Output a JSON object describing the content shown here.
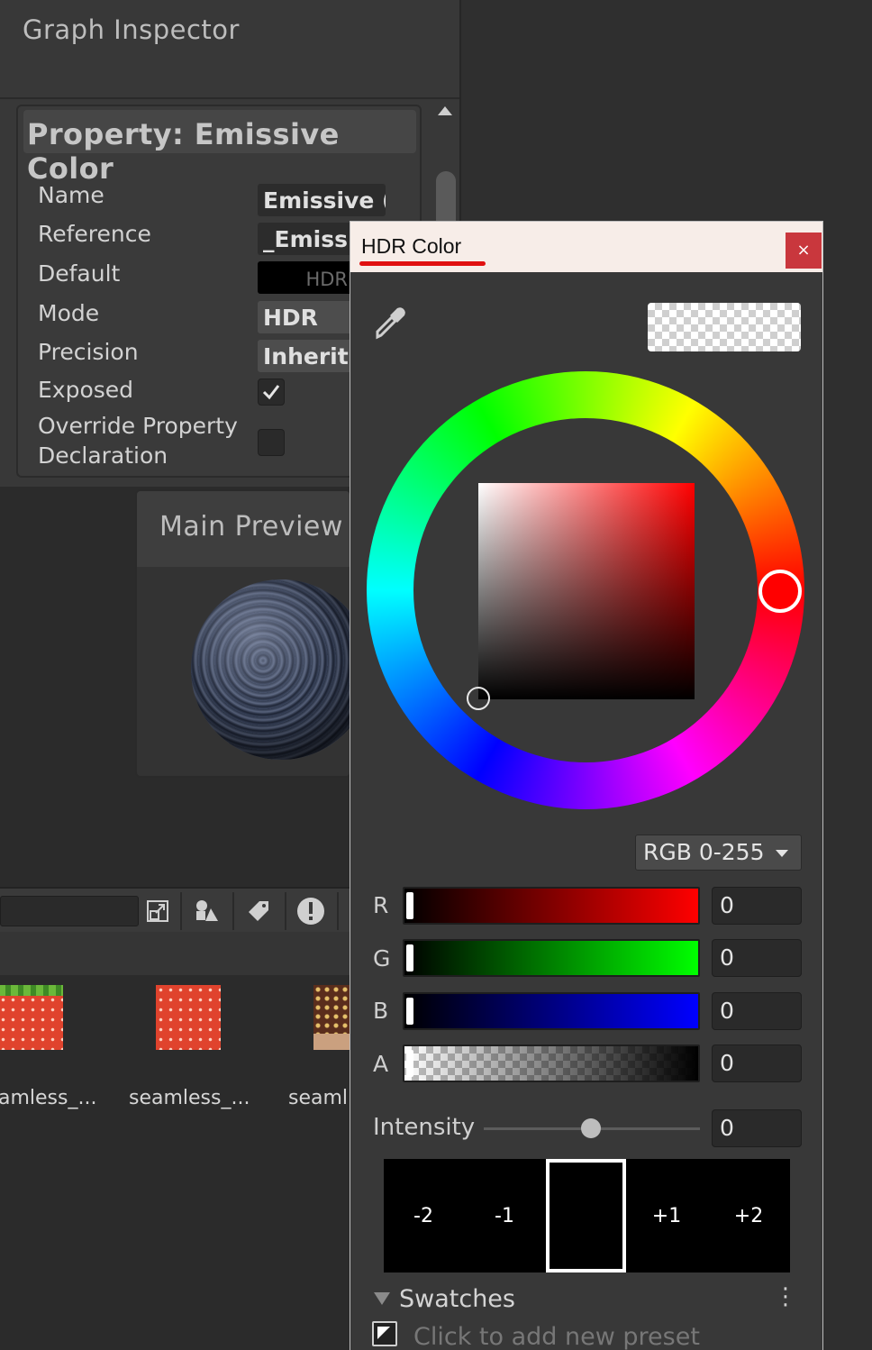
{
  "inspector": {
    "title": "Graph Inspector",
    "property_header": "Property: Emissive Color",
    "rows": {
      "name_label": "Name",
      "name_value": "Emissive (",
      "reference_label": "Reference",
      "reference_value": "_Emissi",
      "default_label": "Default",
      "default_value": "HDR",
      "mode_label": "Mode",
      "mode_value": "HDR",
      "precision_label": "Precision",
      "precision_value": "Inherit",
      "exposed_label": "Exposed",
      "exposed_checked": true,
      "override_label_line1": "Override Property",
      "override_label_line2": "Declaration",
      "override_checked": false
    }
  },
  "preview": {
    "title": "Main Preview"
  },
  "project": {
    "assets": [
      {
        "label": "amless_..."
      },
      {
        "label": "seamless_..."
      },
      {
        "label": "seaml"
      }
    ]
  },
  "hdr_color": {
    "title": "HDR Color",
    "close": "×",
    "mode_dropdown": "RGB 0-255",
    "hue_color": "#ff0000",
    "channels": [
      {
        "label": "R",
        "value": "0"
      },
      {
        "label": "G",
        "value": "0"
      },
      {
        "label": "B",
        "value": "0"
      },
      {
        "label": "A",
        "value": "0"
      }
    ],
    "intensity_label": "Intensity",
    "intensity_value": "0",
    "intensity_level": 0.5,
    "stops": [
      "-2",
      "-1",
      "",
      "+1",
      "+2"
    ],
    "swatches_label": "Swatches",
    "add_preset": "Click to add new preset"
  }
}
